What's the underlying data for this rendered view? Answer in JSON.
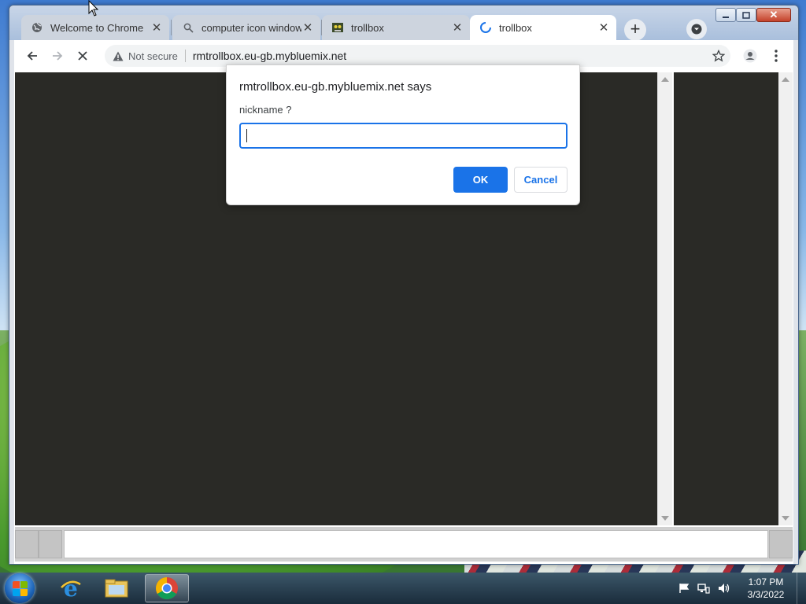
{
  "browser": {
    "tabs": [
      {
        "title": "Welcome to Chrome",
        "icon": "chrome-globe-icon",
        "active": false
      },
      {
        "title": "computer icon windows",
        "icon": "search-icon",
        "active": false
      },
      {
        "title": "trollbox",
        "icon": "trollbox-favicon-icon",
        "active": false
      },
      {
        "title": "trollbox",
        "icon": "loading-spinner-icon",
        "active": true
      }
    ],
    "close_glyph": "✕",
    "new_tab_glyph": "+",
    "window_controls": {
      "minimize": "minimize-icon",
      "maximize": "maximize-icon",
      "close": "✕"
    },
    "omnibox": {
      "security_label": "Not secure",
      "url": "rmtrollbox.eu-gb.mybluemix.net"
    }
  },
  "dialog": {
    "title": "rmtrollbox.eu-gb.mybluemix.net says",
    "message": "nickname ?",
    "input_value": "",
    "ok_label": "OK",
    "cancel_label": "Cancel"
  },
  "page": {
    "background_color": "#2a2a26"
  },
  "taskbar": {
    "pinned": [
      "internet-explorer-icon",
      "file-explorer-icon",
      "chrome-icon"
    ],
    "tray_icons": [
      "action-center-flag-icon",
      "network-icon",
      "volume-icon"
    ],
    "clock_time": "1:07 PM",
    "clock_date": "3/3/2022"
  },
  "colors": {
    "accent": "#1a73e8",
    "tab_active": "#ffffff",
    "page_dark": "#2a2a26"
  }
}
